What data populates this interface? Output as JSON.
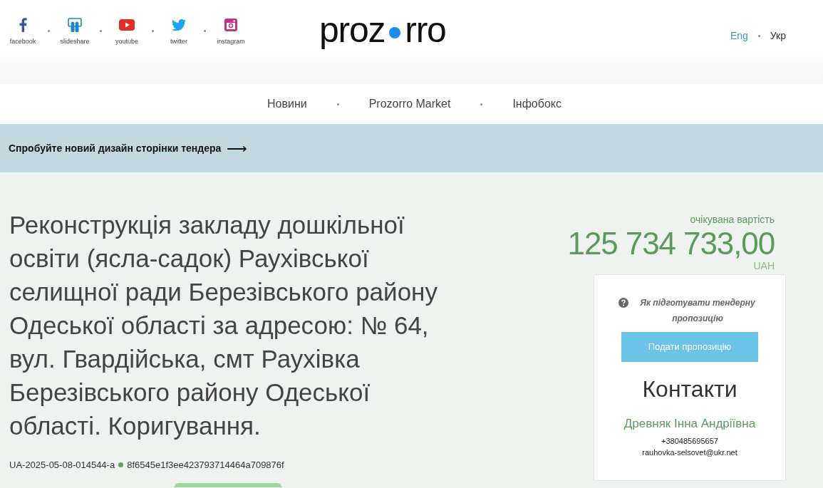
{
  "social": [
    {
      "kind": "facebook",
      "label": "facebook"
    },
    {
      "kind": "slideshare",
      "label": "slideshare"
    },
    {
      "kind": "youtube",
      "label": "youtube"
    },
    {
      "kind": "twitter",
      "label": "twitter"
    },
    {
      "kind": "instagram",
      "label": "instagram"
    }
  ],
  "logo": {
    "left": "proz",
    "right": "rro"
  },
  "languages": [
    {
      "label": "Eng",
      "selected": false
    },
    {
      "label": "Укр",
      "selected": true
    }
  ],
  "nav": [
    "Новини",
    "Prozorro Market",
    "Інфобокс"
  ],
  "banner": {
    "text": "Спробуйте новий дизайн сторінки тендера",
    "arrow": "⟶"
  },
  "tender": {
    "title": "Реконструкція закладу дошкільної освіти (ясла-садок) Раухівської селищної ради Березівського району Одеської області за адресою: № 64, вул. Гвардійська, смт Раухівка Березівського району Одеської області. Коригування.",
    "id": "UA-2025-05-08-014544-a",
    "hash": "8f6545e1f3ee423793714464a709876f"
  },
  "value": {
    "label": "очікувана вартість",
    "amount": "125 734 733,00",
    "currency": "UAH"
  },
  "panel": {
    "help": "Як підготувати тендерну пропозицію",
    "submit": "Подати пропозицію",
    "contacts_title": "Контакти",
    "contact_name": "Древняк Інна Андріївна",
    "phone": "+380485695657",
    "email": "rauhovka-selsovet@ukr.net"
  }
}
